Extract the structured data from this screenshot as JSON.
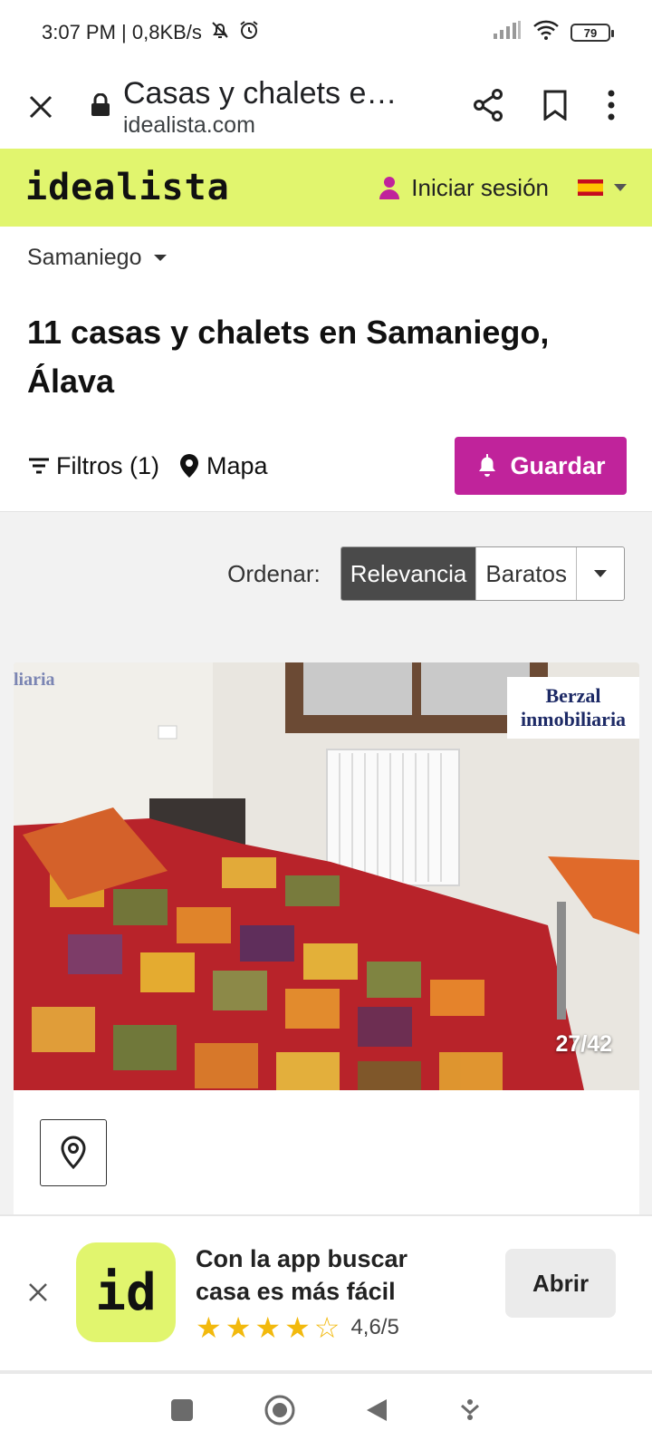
{
  "status_bar": {
    "time_speed": "3:07 PM | 0,8KB/s",
    "battery": "79"
  },
  "browser": {
    "page_title": "Casas y chalets e…",
    "domain": "idealista.com"
  },
  "site_header": {
    "logo": "idealista",
    "login_label": "Iniciar sesión",
    "brand_color": "#e1f56e"
  },
  "search": {
    "location": "Samaniego",
    "title": "11 casas y chalets en Samaniego, Álava",
    "filters_label": "Filtros (1)",
    "map_label": "Mapa",
    "save_label": "Guardar",
    "save_color": "#c0239b"
  },
  "sort": {
    "label": "Ordenar:",
    "options": [
      "Relevancia",
      "Baratos"
    ],
    "selected": "Relevancia"
  },
  "listing": {
    "photo_counter": "27/42",
    "watermark_line1": "Berzal",
    "watermark_line2": "inmobiliaria",
    "watermark_faint": "liaria"
  },
  "app_banner": {
    "icon_text": "id",
    "line1": "Con la app buscar",
    "line2": "casa es más fácil",
    "rating": "4,6/5",
    "open_label": "Abrir"
  }
}
